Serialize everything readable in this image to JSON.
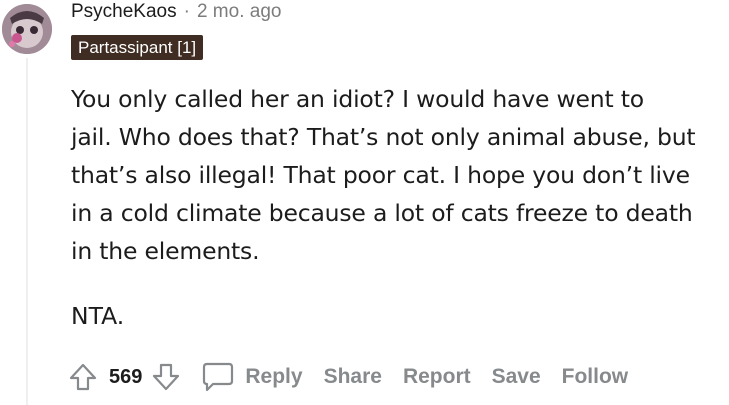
{
  "comment": {
    "username": "PsycheKaos",
    "separator": "·",
    "age": "2 mo. ago",
    "flair": "Partassipant [1]",
    "body_lines": [
      "You only called her an idiot? I would have went to",
      "jail. Who does that? That’s not only animal abuse, but",
      "that’s also illegal! That poor cat. I hope you don’t live",
      "in a cold climate because a lot of cats freeze to death",
      "in the elements."
    ],
    "verdict": "NTA."
  },
  "actions": {
    "vote_count": "569",
    "reply": "Reply",
    "share": "Share",
    "report": "Report",
    "save": "Save",
    "follow": "Follow"
  },
  "icons": {
    "upvote": "arrow-up-icon",
    "downvote": "arrow-down-icon",
    "comment": "speech-bubble-icon"
  },
  "colors": {
    "flair_bg": "#3f2c22",
    "action_text": "#878a8c",
    "text": "#1c1c1c"
  }
}
